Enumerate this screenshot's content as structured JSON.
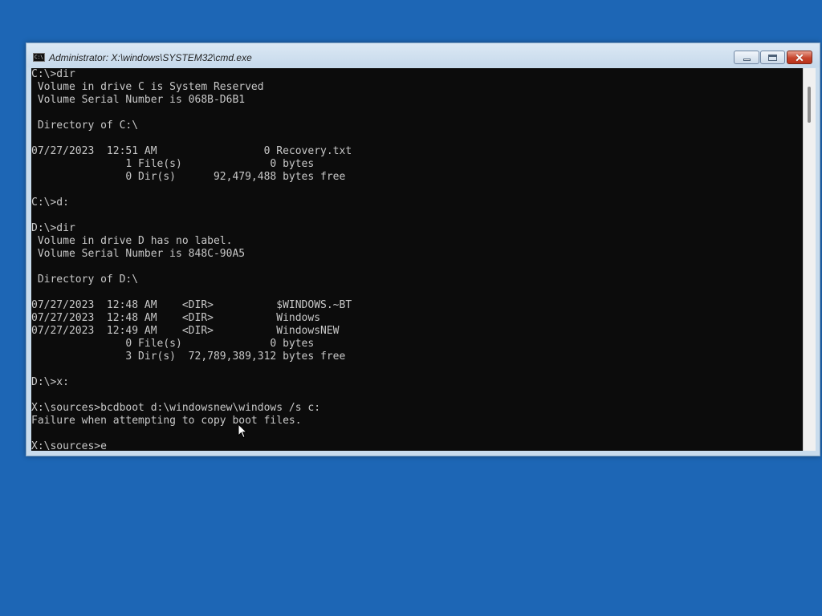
{
  "window": {
    "title": "Administrator: X:\\windows\\SYSTEM32\\cmd.exe",
    "icon_label": "C:\\",
    "icon": "cmd-icon",
    "buttons": {
      "minimize_icon": "minimize-icon",
      "maximize_icon": "maximize-icon",
      "close_icon": "close-icon",
      "close_glyph": "✕"
    }
  },
  "console": {
    "lines": [
      "C:\\>dir",
      " Volume in drive C is System Reserved",
      " Volume Serial Number is 068B-D6B1",
      "",
      " Directory of C:\\",
      "",
      "07/27/2023  12:51 AM                 0 Recovery.txt",
      "               1 File(s)              0 bytes",
      "               0 Dir(s)      92,479,488 bytes free",
      "",
      "C:\\>d:",
      "",
      "D:\\>dir",
      " Volume in drive D has no label.",
      " Volume Serial Number is 848C-90A5",
      "",
      " Directory of D:\\",
      "",
      "07/27/2023  12:48 AM    <DIR>          $WINDOWS.~BT",
      "07/27/2023  12:48 AM    <DIR>          Windows",
      "07/27/2023  12:49 AM    <DIR>          WindowsNEW",
      "               0 File(s)              0 bytes",
      "               3 Dir(s)  72,789,389,312 bytes free",
      "",
      "D:\\>x:",
      "",
      "X:\\sources>bcdboot d:\\windowsnew\\windows /s c:",
      "Failure when attempting to copy boot files.",
      "",
      "X:\\sources>e"
    ]
  },
  "colors": {
    "desktop": "#1d66b5",
    "console_bg": "#0c0c0c",
    "console_text": "#c8c8c8",
    "close_button": "#c7452d"
  }
}
